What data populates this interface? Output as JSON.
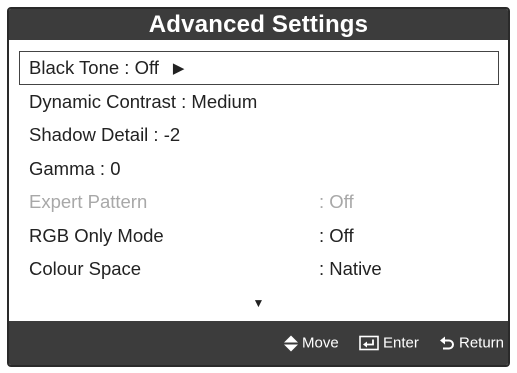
{
  "title": "Advanced Settings",
  "menu": [
    {
      "text": "Black Tone  : Off",
      "value": "",
      "selected": true,
      "disabled": false,
      "has_submenu_arrow": true,
      "arrow_glyph": "▶"
    },
    {
      "text": "Dynamic Contrast  : Medium",
      "value": "",
      "selected": false,
      "disabled": false
    },
    {
      "text": "Shadow Detail  : -2",
      "value": "",
      "selected": false,
      "disabled": false
    },
    {
      "text": "Gamma  : 0",
      "value": "",
      "selected": false,
      "disabled": false
    },
    {
      "text": "Expert Pattern",
      "value": ": Off",
      "selected": false,
      "disabled": true
    },
    {
      "text": "RGB Only Mode",
      "value": ": Off",
      "selected": false,
      "disabled": false
    },
    {
      "text": "Colour Space",
      "value": ": Native",
      "selected": false,
      "disabled": false
    }
  ],
  "more_indicator": "▼",
  "footer": {
    "move_label": "Move",
    "enter_label": "Enter",
    "return_label": "Return",
    "move_icon": "up-down-arrows-icon",
    "enter_icon": "enter-icon",
    "return_icon": "return-icon"
  },
  "colors": {
    "bar_background": "#3c3c3c",
    "text": "#222222",
    "disabled_text": "#a8a8a8"
  }
}
